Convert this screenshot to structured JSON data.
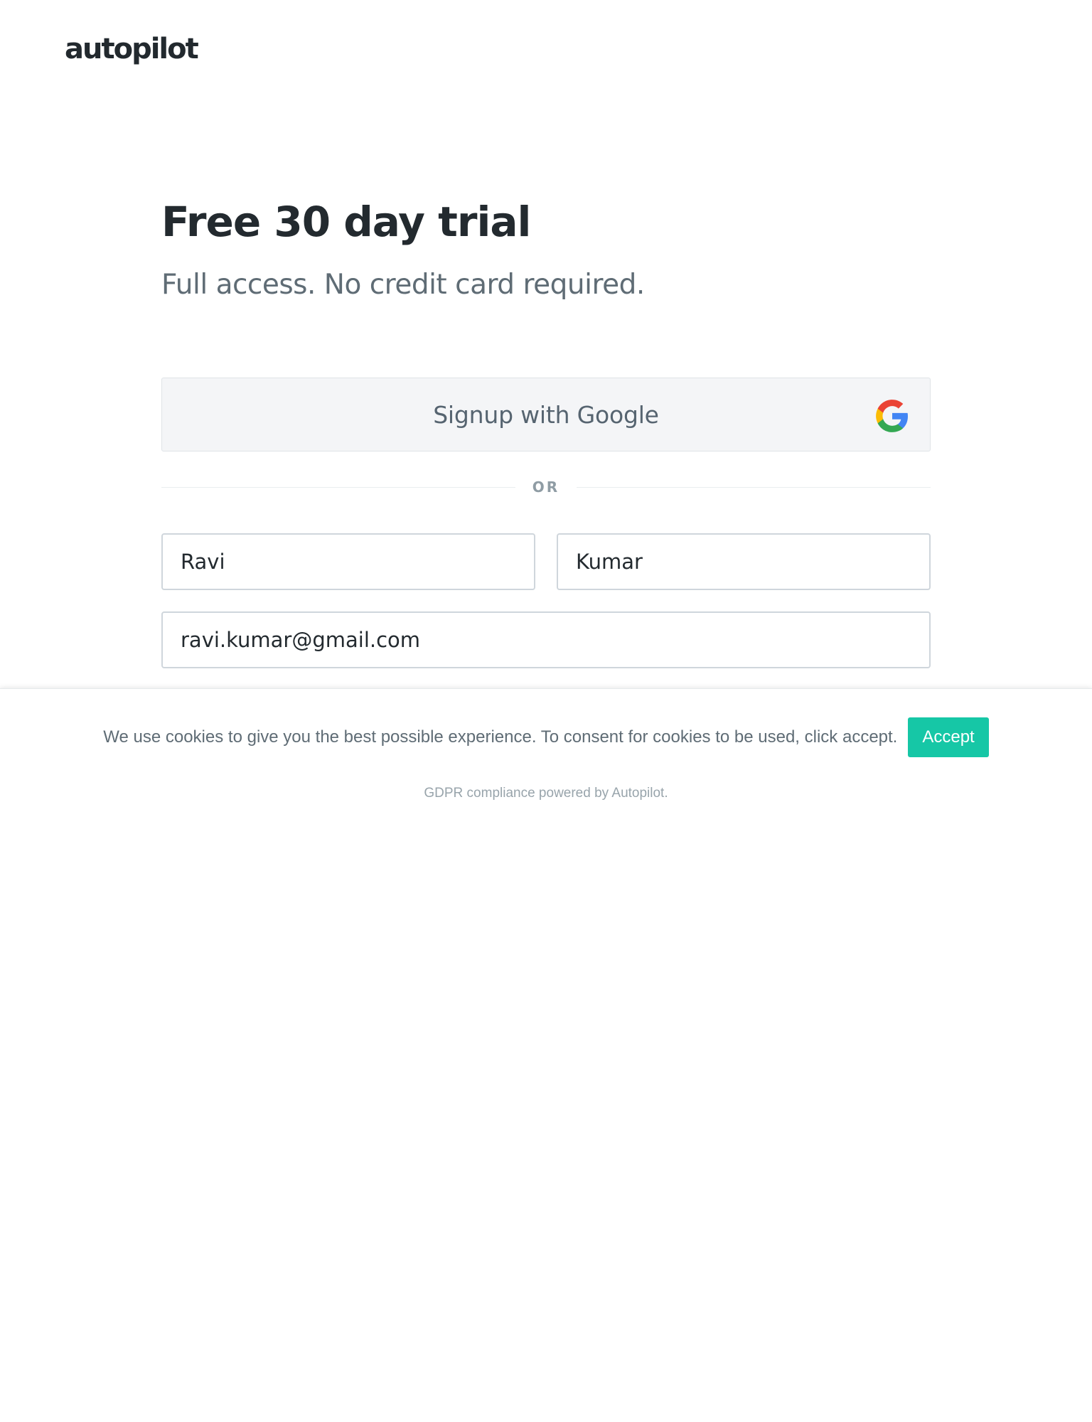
{
  "brand": {
    "logo_text": "autopilot"
  },
  "hero": {
    "title": "Free 30 day trial",
    "subtitle": "Full access. No credit card required."
  },
  "google_signup": {
    "label": "Signup with Google",
    "icon": "google-g-icon"
  },
  "divider": {
    "label": "OR"
  },
  "form": {
    "first_name": {
      "value": "Ravi"
    },
    "last_name": {
      "value": "Kumar"
    },
    "email": {
      "value": "ravi.kumar@gmail.com"
    }
  },
  "cookie_banner": {
    "message": "We use cookies to give you the best possible experience. To consent for cookies to be used, click accept.",
    "accept_label": "Accept",
    "footer": "GDPR compliance powered by Autopilot."
  },
  "colors": {
    "accent": "#16c7a6",
    "heading": "#232a2f",
    "muted": "#5f6c75"
  }
}
